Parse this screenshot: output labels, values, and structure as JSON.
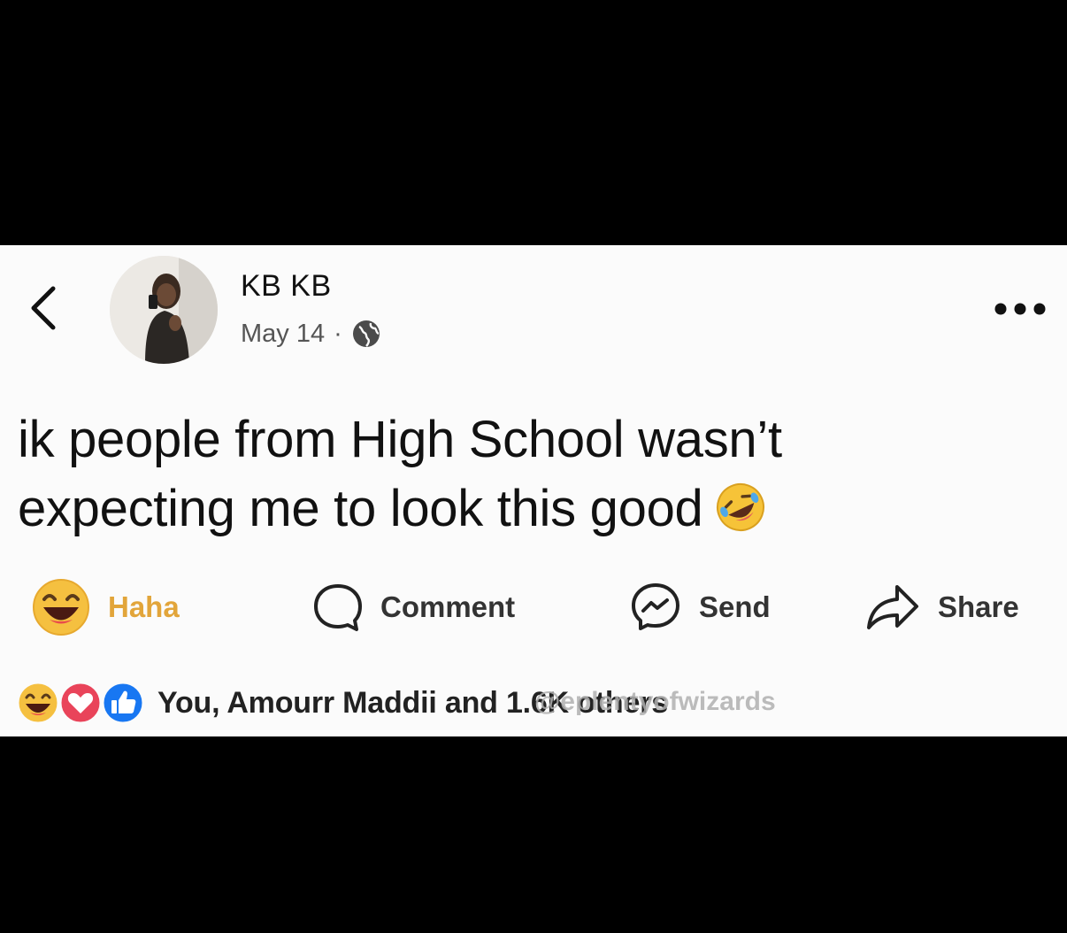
{
  "post": {
    "author_name": "KB KB",
    "date": "May 14",
    "separator": "·",
    "visibility_icon": "globe-icon",
    "text_line1": "ik people from High School wasn’t",
    "text_line2": "expecting me to look this good",
    "text_emoji": "rolling-on-floor-laughing"
  },
  "actions": {
    "haha_label": "Haha",
    "comment_label": "Comment",
    "send_label": "Send",
    "share_label": "Share"
  },
  "reactions": {
    "icons": [
      "haha-icon",
      "love-icon",
      "like-icon"
    ],
    "summary": "You, Amourr Maddii and 1.6K others"
  },
  "watermark": "@eplentyofwizards",
  "colors": {
    "haha_accent": "#e2a53a",
    "like_blue": "#1877f2",
    "love_red": "#f33e58",
    "background": "#000000",
    "card": "#fbfbfb"
  }
}
